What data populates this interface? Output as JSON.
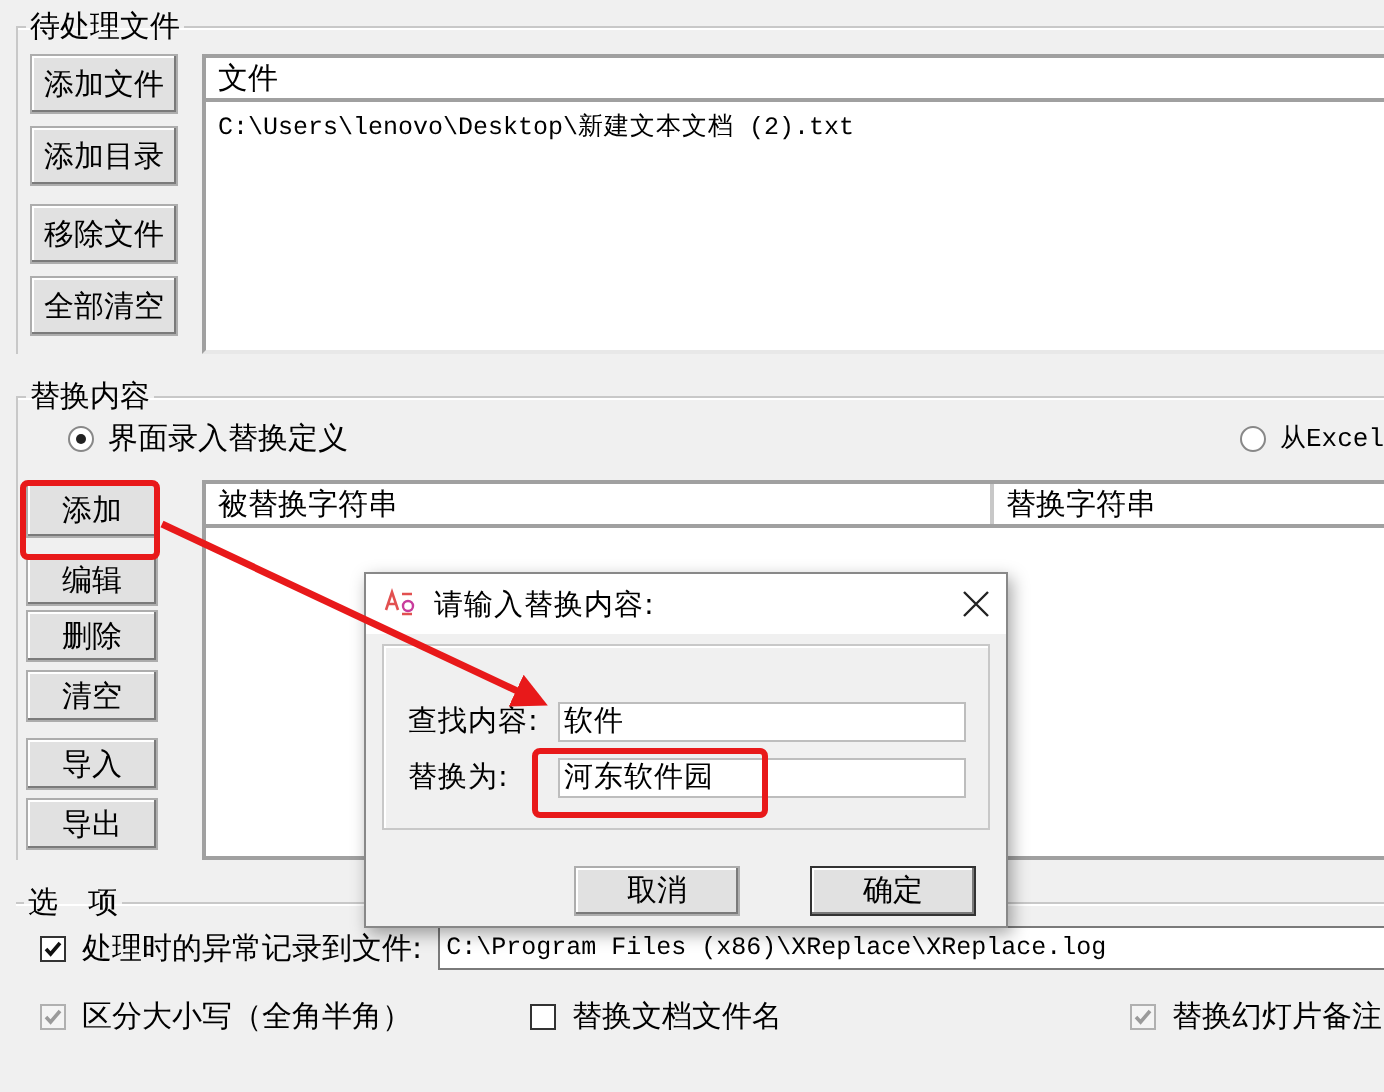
{
  "files_group": {
    "title": "待处理文件",
    "buttons": [
      "添加文件",
      "添加目录",
      "移除文件",
      "全部清空"
    ],
    "list": {
      "column": "文件",
      "rows": [
        "C:\\Users\\lenovo\\Desktop\\新建文本文档 (2).txt"
      ]
    }
  },
  "replace_group": {
    "title": "替换内容",
    "modes": [
      {
        "label": "界面录入替换定义",
        "selected": true
      },
      {
        "label": "从Excel",
        "selected": false
      }
    ],
    "buttons": [
      "添加",
      "编辑",
      "删除",
      "清空",
      "导入",
      "导出"
    ],
    "columns": [
      "被替换字符串",
      "替换字符串"
    ]
  },
  "options_group": {
    "title": "选　项",
    "log": {
      "label": "处理时的异常记录到文件:",
      "checked": true,
      "value": "C:\\Program Files (x86)\\XReplace\\XReplace.log"
    },
    "options": [
      {
        "label": "区分大小写（全角半角）",
        "checked": true,
        "disabled": true
      },
      {
        "label": "替换文档文件名",
        "checked": false,
        "disabled": false
      },
      {
        "label": "替换幻灯片备注",
        "checked": true,
        "disabled": true
      }
    ]
  },
  "dialog": {
    "title": "请输入替换内容:",
    "fields": [
      {
        "label": "查找内容:",
        "value": "软件"
      },
      {
        "label": "替换为:",
        "value": "河东软件园"
      }
    ],
    "buttons": [
      {
        "label": "取消",
        "default": false
      },
      {
        "label": "确定",
        "default": true
      }
    ]
  }
}
